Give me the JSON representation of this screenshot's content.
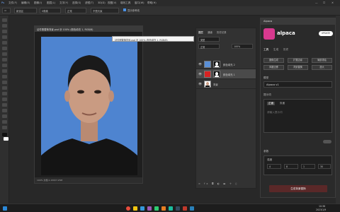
{
  "menubar": {
    "items": [
      "文件(F)",
      "编辑(E)",
      "图像(I)",
      "图层(L)",
      "文字(Y)",
      "选择(S)",
      "滤镜(T)",
      "3D(D)",
      "视图(V)",
      "增效工具",
      "窗口(W)",
      "帮助(H)"
    ]
  },
  "options": {
    "mode_label": "新选区",
    "feather": "0像素",
    "style": "正常",
    "ratio": "不受约束",
    "checkbox_label": "显示参考线"
  },
  "document": {
    "title": "证件照替换背景.psd @ 100% (颜色填充 1, RGB/8)",
    "status": "100%  文档:1.15M/7.25M",
    "tooltip": "证件照替换背景.psd @ 100% (颜色填充 1, RGB/8)"
  },
  "layers": {
    "tabs": [
      "图层",
      "通道",
      "历史记录"
    ],
    "filter_label": "类型",
    "blend_mode": "正常",
    "opacity": "100%",
    "rows": [
      {
        "name": "颜色填充 2",
        "color": "#5a8fd6"
      },
      {
        "name": "颜色填充 1",
        "color": "#d72222"
      },
      {
        "name": "背景",
        "color": "#ffffff"
      }
    ]
  },
  "alpaca": {
    "panel_title": "Alpaca",
    "brand": "alpaca",
    "badge": "UPDATE",
    "tabs": [
      "工具",
      "生成",
      "历史"
    ],
    "buttons": [
      "图像生成",
      "扩展边缘",
      "局部重绘",
      "风格迁移",
      "背景替换",
      "放大"
    ],
    "model_label": "模型",
    "model_value": "Alpaca v1",
    "prompt_label": "提示词",
    "prompt_tabs": [
      "正面",
      "负面"
    ],
    "prompt_placeholder": "请输入提示词",
    "params_label": "参数",
    "strength_label": "强度",
    "strength_values": [
      "4",
      "8",
      "1",
      "30"
    ],
    "action_label": "生成背景替换",
    "status_label": "就绪"
  },
  "taskbar": {
    "time": "10:36",
    "date": "2023/1/9"
  }
}
